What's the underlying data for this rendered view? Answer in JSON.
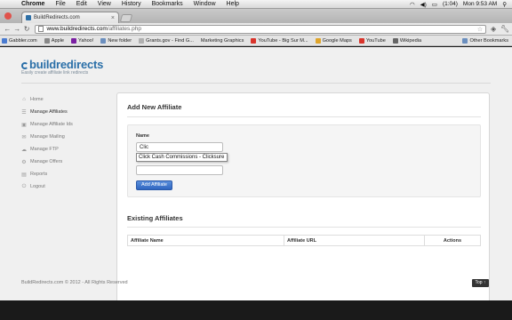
{
  "menubar": {
    "app": "Chrome",
    "items": [
      "File",
      "Edit",
      "View",
      "History",
      "Bookmarks",
      "Window",
      "Help"
    ],
    "battery": "(1:04)",
    "clock": "Mon 9:53 AM"
  },
  "browser": {
    "tab_title": "BuildRedirects.com",
    "url_host": "www.buildredirects.com",
    "url_path": "/affiliates.php",
    "bookmarks": [
      {
        "label": "Gabbler.com",
        "color": "#4a7bd0"
      },
      {
        "label": "Apple",
        "color": "#888888"
      },
      {
        "label": "Yahoo!",
        "color": "#7a1fa2"
      },
      {
        "label": "New folder",
        "color": "#6b8fbf"
      },
      {
        "label": "Grants.gov - Find G...",
        "color": "#b0b0b0"
      },
      {
        "label": "Marketing Graphics",
        "color": "#b0b0b0"
      },
      {
        "label": "YouTube - Big Sur M...",
        "color": "#d9342b"
      },
      {
        "label": "Google Maps",
        "color": "#e0a52a"
      },
      {
        "label": "YouTube",
        "color": "#d9342b"
      },
      {
        "label": "Wikipedia",
        "color": "#666666"
      }
    ],
    "other_bookmarks": "Other Bookmarks"
  },
  "site": {
    "logo_text": "buildredirects",
    "tagline": "Easily create affiliate link redirects",
    "accent": "#2a6fa8"
  },
  "sidebar": {
    "items": [
      {
        "label": "Home",
        "icon": "home-icon",
        "glyph": "⌂"
      },
      {
        "label": "Manage Affiliates",
        "icon": "list-icon",
        "glyph": "☰"
      },
      {
        "label": "Manage Affiliate Ids",
        "icon": "tag-icon",
        "glyph": "▣"
      },
      {
        "label": "Manage Mailing",
        "icon": "envelope-icon",
        "glyph": "✉"
      },
      {
        "label": "Manage FTP",
        "icon": "cloud-icon",
        "glyph": "☁"
      },
      {
        "label": "Manage Offers",
        "icon": "gear-icon",
        "glyph": "⚙"
      },
      {
        "label": "Reports",
        "icon": "report-icon",
        "glyph": "▤"
      },
      {
        "label": "Logout",
        "icon": "power-icon",
        "glyph": "⏻"
      }
    ]
  },
  "main": {
    "add_title": "Add New Affiliate",
    "name_label": "Name",
    "name_value": "Clic",
    "suggestion": "Click Cash Commissions - Clicksure",
    "second_value": "",
    "add_button": "Add Affiliate",
    "existing_title": "Existing Affiliates",
    "table_headers": [
      "Affiliate Name",
      "Affiliate URL",
      "Actions"
    ]
  },
  "footer": {
    "copyright": "BuildRedirects.com © 2012 - All Rights Reserved",
    "top_button": "Top ↑"
  }
}
